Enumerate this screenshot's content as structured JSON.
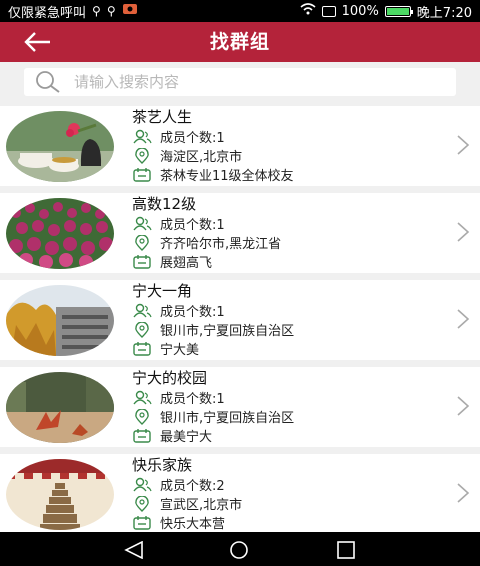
{
  "status_bar": {
    "left_text": "仅限紧急呼叫",
    "left_icons": [
      "usb-icon",
      "usb-icon",
      "notification-icon"
    ],
    "battery_percent": "100%",
    "time": "晚上7:20"
  },
  "header": {
    "title": "找群组",
    "back_icon": "arrow-left-icon",
    "color": "#b4233a"
  },
  "search": {
    "placeholder": "请输入搜索内容",
    "value": ""
  },
  "groups": [
    {
      "name": "茶艺人生",
      "member_label": "成员个数:1",
      "location": "海淀区,北京市",
      "description": "茶林专业11级全体校友"
    },
    {
      "name": "高数12级",
      "member_label": "成员个数:1",
      "location": "齐齐哈尔市,黑龙江省",
      "description": "展翅高飞"
    },
    {
      "name": "宁大一角",
      "member_label": "成员个数:1",
      "location": "银川市,宁夏回族自治区",
      "description": "宁大美"
    },
    {
      "name": "宁大的校园",
      "member_label": "成员个数:1",
      "location": "银川市,宁夏回族自治区",
      "description": "最美宁大"
    },
    {
      "name": "快乐家族",
      "member_label": "成员个数:2",
      "location": "宣武区,北京市",
      "description": "快乐大本营"
    }
  ],
  "icons": {
    "members": "people-icon",
    "location": "location-pin-icon",
    "description": "calendar-icon",
    "row_chevron": "chevron-right-icon"
  },
  "nav": [
    "back-triangle-icon",
    "home-circle-icon",
    "recents-square-icon"
  ]
}
